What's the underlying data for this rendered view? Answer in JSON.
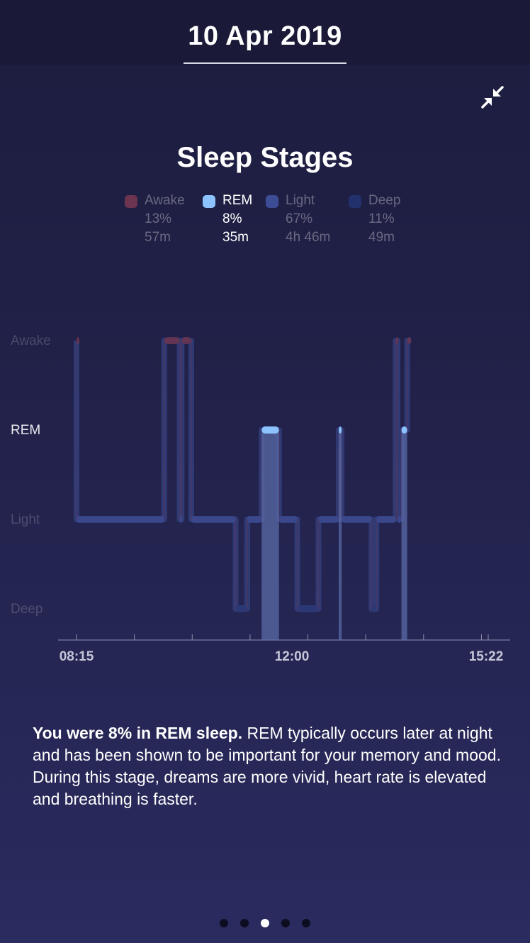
{
  "header": {
    "date": "10 Apr 2019"
  },
  "title": "Sleep Stages",
  "legend": [
    {
      "key": "awake",
      "name": "Awake",
      "percent": "13%",
      "duration": "57m",
      "color": "#6b3550",
      "active": false
    },
    {
      "key": "rem",
      "name": "REM",
      "percent": "8%",
      "duration": "35m",
      "color": "#8cc3ff",
      "active": true
    },
    {
      "key": "light",
      "name": "Light",
      "percent": "67%",
      "duration": "4h 46m",
      "color": "#3d4d95",
      "active": false
    },
    {
      "key": "deep",
      "name": "Deep",
      "percent": "11%",
      "duration": "49m",
      "color": "#22306b",
      "active": false
    }
  ],
  "chart_data": {
    "type": "line",
    "stages": [
      "Awake",
      "REM",
      "Light",
      "Deep"
    ],
    "x_labels": [
      "08:15",
      "12:00",
      "15:22"
    ],
    "start_time": "08:15",
    "end_time": "15:22",
    "highlighted_stage": "REM",
    "segments": [
      {
        "stage": "Awake",
        "start": "08:15",
        "end": "08:15"
      },
      {
        "stage": "Light",
        "start": "08:15",
        "end": "09:46"
      },
      {
        "stage": "Awake",
        "start": "09:46",
        "end": "10:02"
      },
      {
        "stage": "Light",
        "start": "10:02",
        "end": "10:04"
      },
      {
        "stage": "Awake",
        "start": "10:04",
        "end": "10:14"
      },
      {
        "stage": "Light",
        "start": "10:14",
        "end": "11:00"
      },
      {
        "stage": "Deep",
        "start": "11:00",
        "end": "11:12"
      },
      {
        "stage": "Light",
        "start": "11:12",
        "end": "11:27"
      },
      {
        "stage": "REM",
        "start": "11:27",
        "end": "11:45"
      },
      {
        "stage": "Light",
        "start": "11:45",
        "end": "12:04"
      },
      {
        "stage": "Deep",
        "start": "12:04",
        "end": "12:26"
      },
      {
        "stage": "Light",
        "start": "12:26",
        "end": "12:47"
      },
      {
        "stage": "REM",
        "start": "12:47",
        "end": "12:50"
      },
      {
        "stage": "Light",
        "start": "12:50",
        "end": "13:21"
      },
      {
        "stage": "Deep",
        "start": "13:21",
        "end": "13:26"
      },
      {
        "stage": "Light",
        "start": "13:26",
        "end": "13:46"
      },
      {
        "stage": "Awake",
        "start": "13:46",
        "end": "13:48"
      },
      {
        "stage": "Light",
        "start": "13:48",
        "end": "13:52"
      },
      {
        "stage": "REM",
        "start": "13:52",
        "end": "13:58"
      },
      {
        "stage": "Awake",
        "start": "13:58",
        "end": "14:02"
      }
    ]
  },
  "description": {
    "highlight": "You were 8% in REM sleep.",
    "body": " REM typically occurs later at night and has been shown to be important for your memory and mood. During this stage, dreams are more vivid, heart rate is elevated and breathing is faster."
  },
  "pagination": {
    "count": 5,
    "active_index": 2
  },
  "icons": {
    "collapse": "collapse-arrows-icon"
  }
}
